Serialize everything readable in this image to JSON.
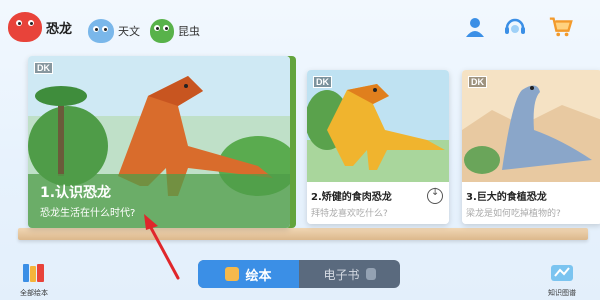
{
  "categories": [
    {
      "label": "恐龙",
      "active": true,
      "mascot": "dinosaur-mascot"
    },
    {
      "label": "天文",
      "active": false,
      "mascot": "astronaut-mascot"
    },
    {
      "label": "昆虫",
      "active": false,
      "mascot": "insect-mascot"
    }
  ],
  "top_icons": [
    {
      "name": "user-profile-icon"
    },
    {
      "name": "customer-service-icon"
    },
    {
      "name": "shopping-cart-icon"
    }
  ],
  "books": [
    {
      "badge": "DK",
      "title": "1.认识恐龙",
      "subtitle": "恐龙生活在什么时代?"
    },
    {
      "badge": "DK",
      "title": "2.矫健的食肉恐龙",
      "subtitle": "拜特龙喜欢吃什么?"
    },
    {
      "badge": "DK",
      "title": "3.巨大的食植恐龙",
      "subtitle": "梁龙是如何吃掉植物的?"
    }
  ],
  "bottom": {
    "left_label": "全部绘本",
    "right_label": "知识图谱"
  },
  "tabs": [
    {
      "label": "绘本",
      "active": true
    },
    {
      "label": "电子书",
      "active": false
    }
  ],
  "colors": {
    "accent": "#3b8fe6",
    "tab_bar": "#5a6a7e",
    "arrow": "#e0262b",
    "shelf": "#e7c8a0"
  }
}
